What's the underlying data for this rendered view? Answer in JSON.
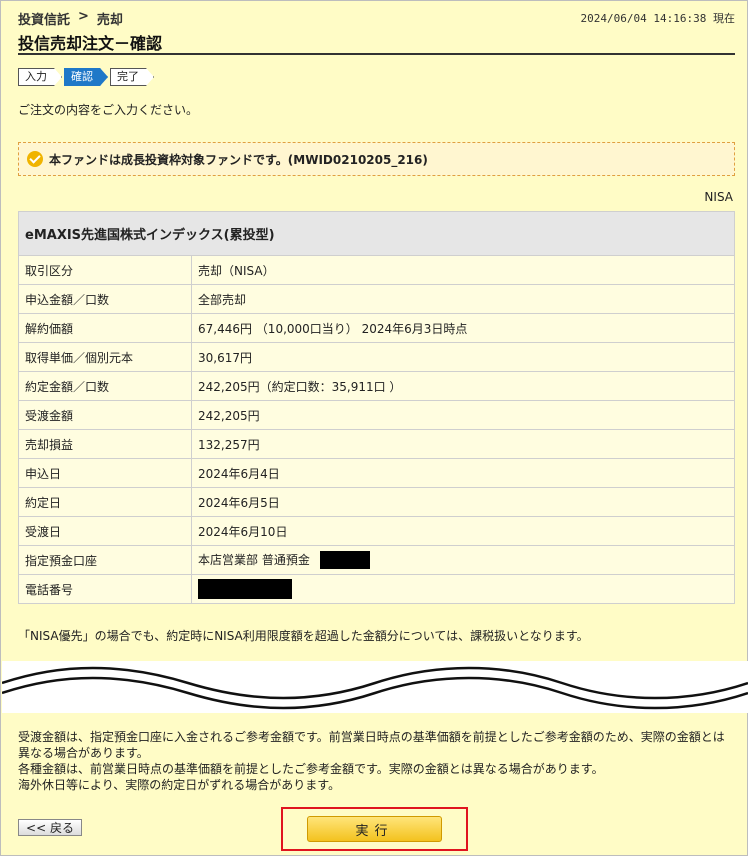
{
  "breadcrumb": {
    "parent": "投資信託",
    "separator": ">",
    "current": "売却"
  },
  "timestamp": "2024/06/04 14:16:38 現在",
  "page_title": "投信売却注文－確認",
  "steps": [
    {
      "label": "入力",
      "active": false
    },
    {
      "label": "確認",
      "active": true
    },
    {
      "label": "完了",
      "active": false
    }
  ],
  "lead_text": "ご注文の内容をご入力ください。",
  "notice": "本ファンドは成長投資枠対象ファンドです。(MWID0210205_216)",
  "account_tag": "NISA",
  "fund_name": "eMAXIS先進国株式インデックス(累投型)",
  "rows": [
    {
      "label": "取引区分",
      "value": "売却（NISA）"
    },
    {
      "label": "申込金額／口数",
      "value": "全部売却"
    },
    {
      "label": "解約価額",
      "value": "67,446円 （10,000口当り） 2024年6月3日時点"
    },
    {
      "label": "取得単価／個別元本",
      "value": "30,617円"
    },
    {
      "label": "約定金額／口数",
      "value": "242,205円（約定口数：35,911口 ）"
    },
    {
      "label": "受渡金額",
      "value": "242,205円"
    },
    {
      "label": "売却損益",
      "value": "132,257円"
    },
    {
      "label": "申込日",
      "value": "2024年6月4日"
    },
    {
      "label": "約定日",
      "value": "2024年6月5日"
    },
    {
      "label": "受渡日",
      "value": "2024年6月10日"
    },
    {
      "label": "指定預金口座",
      "value": "本店営業部 普通預金"
    },
    {
      "label": "電話番号",
      "value": ""
    }
  ],
  "footnote": "「NISA優先」の場合でも、約定時にNISA利用限度額を超過した金額分については、課税扱いとなります。",
  "notes": [
    "受渡金額は、指定預金口座に入金されるご参考金額です。前営業日時点の基準価額を前提としたご参考金額のため、実際の金額とは異なる場合があります。",
    "各種金額は、前営業日時点の基準価額を前提としたご参考金額です。実際の金額とは異なる場合があります。",
    "海外休日等により、実際の約定日がずれる場合があります。"
  ],
  "buttons": {
    "back": "<< 戻る",
    "execute": "実行"
  },
  "colors": {
    "background": "#fffcc6",
    "accent": "#1f78c8",
    "highlight": "#e0141e"
  }
}
